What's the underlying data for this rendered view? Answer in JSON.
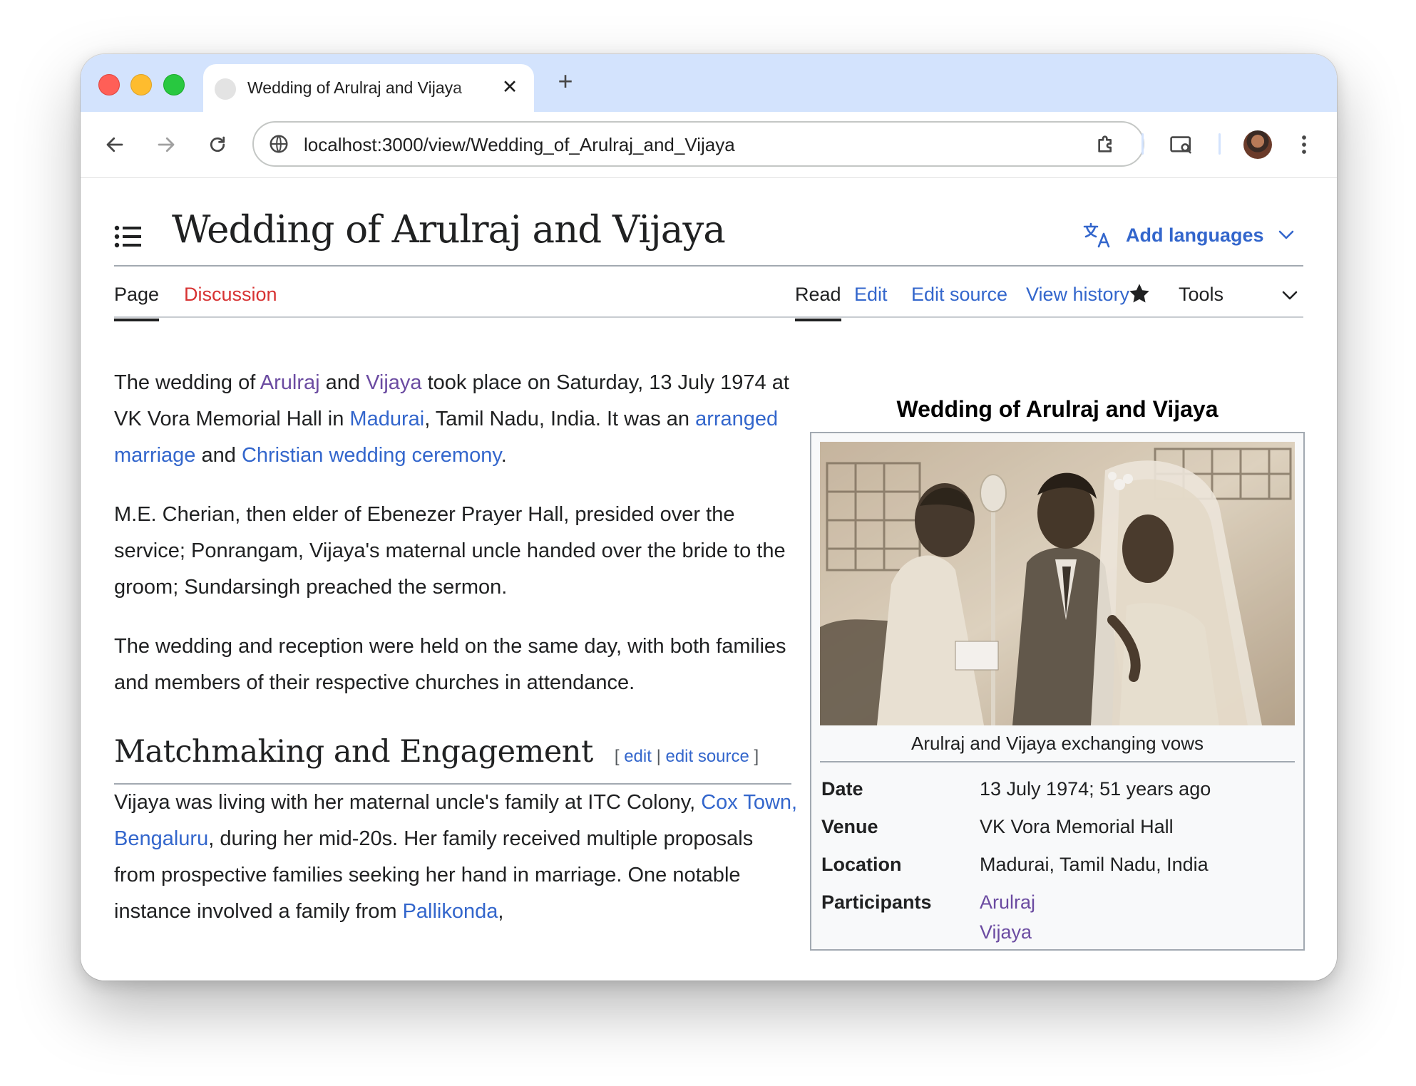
{
  "browser": {
    "tab_title": "Wedding of Arulraj and Vijaya",
    "url": "localhost:3000/view/Wedding_of_Arulraj_and_Vijaya",
    "tab_close": "✕",
    "new_tab": "+"
  },
  "header": {
    "title": "Wedding of Arulraj and Vijaya",
    "add_languages": "Add languages"
  },
  "tabs": {
    "left": [
      "Page",
      "Discussion"
    ],
    "right": [
      "Read",
      "Edit",
      "Edit source",
      "View history"
    ],
    "tools": "Tools"
  },
  "article": {
    "p1": {
      "t1": "The wedding of ",
      "link_arulraj": "Arulraj",
      "t2": " and ",
      "link_vijaya": "Vijaya",
      "t3": " took place on Saturday, 13 July 1974 at VK Vora Memorial Hall in ",
      "link_madurai": "Madurai",
      "t4": ", Tamil Nadu, India. It was an ",
      "link_arranged": "arranged marriage",
      "t5": " and ",
      "link_christian": "Christian wedding ceremony",
      "t6": "."
    },
    "p2": "M.E. Cherian, then elder of Ebenezer Prayer Hall, presided over the service; Ponrangam, Vijaya's maternal uncle handed over the bride to the groom; Sundarsingh preached the sermon.",
    "p3": "The wedding and reception were held on the same day, with both families and members of their respective churches in attendance.",
    "section": {
      "title": "Matchmaking and Engagement",
      "bracket_open": "[",
      "edit": "edit",
      "separator": "|",
      "edit_source": "edit source",
      "bracket_close": "]"
    },
    "p4": {
      "t1": "Vijaya was living with her maternal uncle's family at ITC Colony, ",
      "link_coxtown": "Cox Town, Bengaluru",
      "t2": ", during her mid-20s. Her family received multiple proposals from prospective families seeking her hand in marriage. One notable instance involved a family from ",
      "link_pallikonda": "Pallikonda",
      "t3": ","
    }
  },
  "infobox": {
    "title": "Wedding of Arulraj and Vijaya",
    "image_caption": "Arulraj and Vijaya exchanging vows",
    "rows": [
      {
        "label": "Date",
        "value": "13 July 1974; 51 years ago"
      },
      {
        "label": "Venue",
        "value": "VK Vora Memorial Hall"
      },
      {
        "label": "Location",
        "value": "Madurai, Tamil Nadu, India"
      },
      {
        "label": "Participants",
        "value": "Arulraj",
        "value2": "Vijaya"
      }
    ]
  },
  "colors": {
    "link": "#3366cc",
    "visited_link": "#6b4ba1",
    "discussion_red": "#d73333",
    "tabstrip": "#d3e3fd"
  }
}
